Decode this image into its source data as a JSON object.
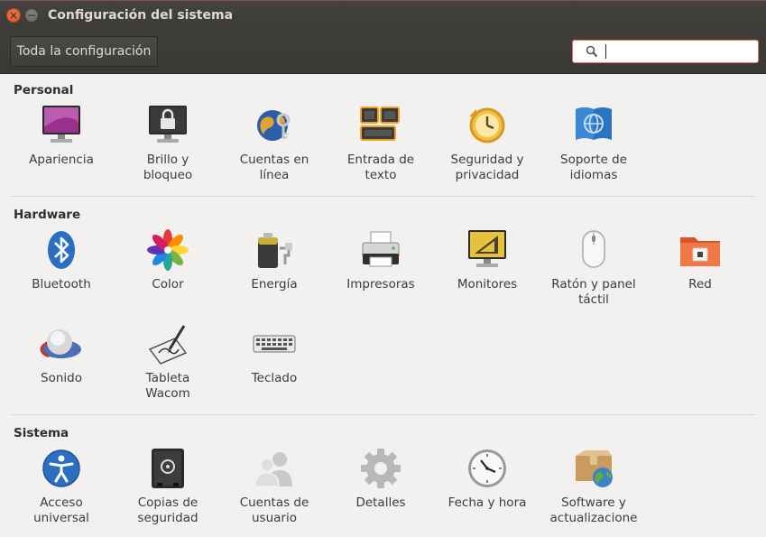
{
  "window": {
    "title": "Configuración del sistema",
    "close_glyph": "×",
    "minimize_glyph": "−"
  },
  "toolbar": {
    "all_settings_label": "Toda la configuración",
    "search_placeholder": "",
    "search_value": ""
  },
  "sections": {
    "personal": {
      "title": "Personal",
      "items": [
        {
          "label": "Apariencia",
          "icon": "appearance-icon"
        },
        {
          "label": "Brillo y\nbloqueo",
          "icon": "brightness-lock-icon"
        },
        {
          "label": "Cuentas en\nlínea",
          "icon": "online-accounts-icon"
        },
        {
          "label": "Entrada de\ntexto",
          "icon": "text-entry-icon"
        },
        {
          "label": "Seguridad y\nprivacidad",
          "icon": "security-privacy-icon"
        },
        {
          "label": "Soporte de\nidiomas",
          "icon": "language-support-icon"
        }
      ]
    },
    "hardware": {
      "title": "Hardware",
      "items": [
        {
          "label": "Bluetooth",
          "icon": "bluetooth-icon"
        },
        {
          "label": "Color",
          "icon": "color-icon"
        },
        {
          "label": "Energía",
          "icon": "power-icon"
        },
        {
          "label": "Impresoras",
          "icon": "printer-icon"
        },
        {
          "label": "Monitores",
          "icon": "displays-icon"
        },
        {
          "label": "Ratón y panel\ntáctil",
          "icon": "mouse-touchpad-icon"
        },
        {
          "label": "Red",
          "icon": "network-icon"
        },
        {
          "label": "Sonido",
          "icon": "sound-icon"
        },
        {
          "label": "Tableta\nWacom",
          "icon": "wacom-tablet-icon"
        },
        {
          "label": "Teclado",
          "icon": "keyboard-icon"
        }
      ]
    },
    "system": {
      "title": "Sistema",
      "items": [
        {
          "label": "Acceso\nuniversal",
          "icon": "universal-access-icon"
        },
        {
          "label": "Copias de\nseguridad",
          "icon": "backups-icon"
        },
        {
          "label": "Cuentas de\nusuario",
          "icon": "user-accounts-icon"
        },
        {
          "label": "Detalles",
          "icon": "details-icon"
        },
        {
          "label": "Fecha y hora",
          "icon": "date-time-icon"
        },
        {
          "label": "Software y\nactualizacione",
          "icon": "software-updates-icon"
        }
      ]
    }
  },
  "colors": {
    "titlebar": "#3c3b37",
    "close_button": "#e0521f",
    "search_focus_border": "#e47b4f",
    "content_bg": "#f2f1f0"
  }
}
